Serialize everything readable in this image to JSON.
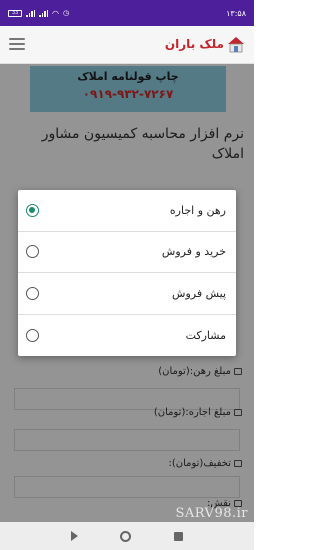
{
  "status_bar": {
    "time": "۱۳:۵۸",
    "battery": "33"
  },
  "header": {
    "logo_text": "ملک باران"
  },
  "banner": {
    "line1": "چاپ قولنامه املاک",
    "line2": "۰۹۱۹-۹۳۲-۷۲۶۷"
  },
  "page": {
    "title": "نرم افزار محاسبه کمیسیون مشاور املاک"
  },
  "form": {
    "rahn_label": "مبلغ رهن:(تومان)",
    "ejare_label": "مبلغ اجاره:(تومان)",
    "takhfif_label": "تخفیف(تومان):",
    "naghsh_label": "نقش:"
  },
  "dialog": {
    "options": [
      {
        "label": "رهن و اجاره",
        "selected": true
      },
      {
        "label": "خرید و فروش",
        "selected": false
      },
      {
        "label": "پیش فروش",
        "selected": false
      },
      {
        "label": "مشارکت",
        "selected": false
      }
    ]
  },
  "watermark": "SARV98.ir",
  "colors": {
    "status_bar": "#4e1f9a",
    "radio_selected": "#1e8a6e",
    "banner_bg": "#8fd3e6",
    "banner_phone": "#d62828"
  }
}
